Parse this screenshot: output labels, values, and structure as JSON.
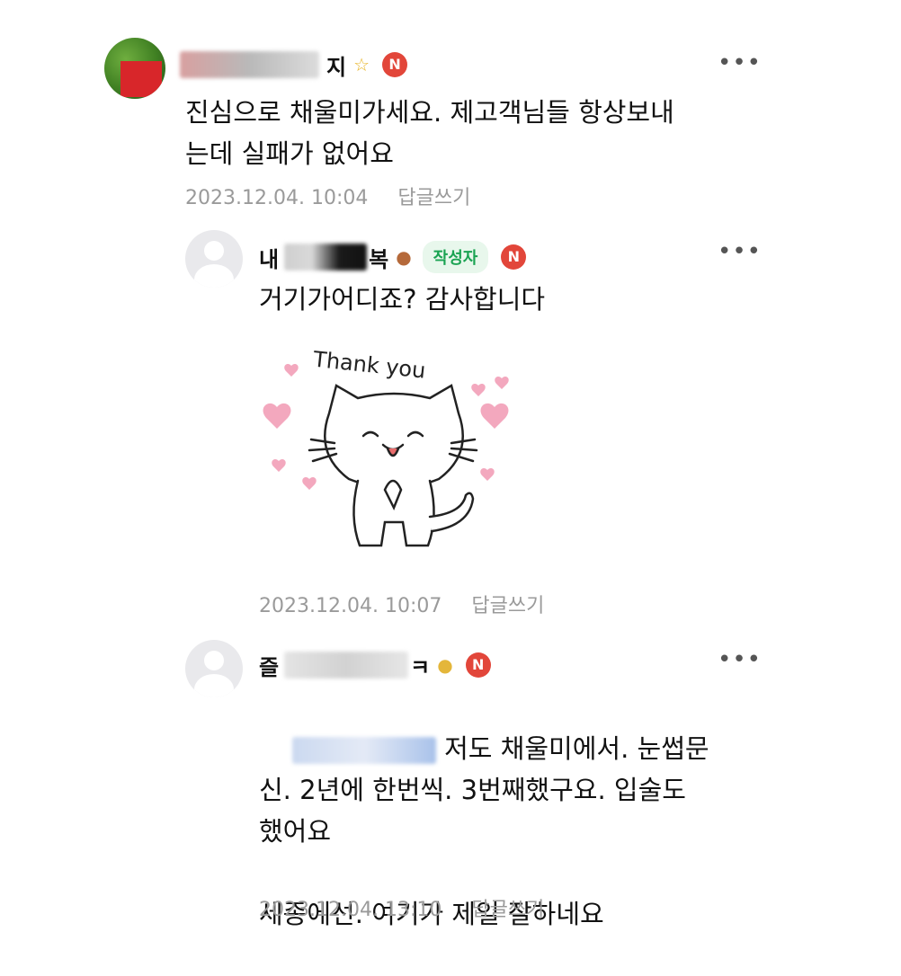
{
  "comments": [
    {
      "name_suffix": "지",
      "text": "진심으로 채울미가세요. 제고객님들 항상보내\n는데 실패가 없어요",
      "timestamp": "2023.12.04. 10:04",
      "reply_label": "답글쓰기",
      "badge": "N",
      "more": "•••"
    },
    {
      "name_prefix": "내",
      "name_suffix": "복",
      "author_tag": "작성자",
      "text": "거기가어디죠? 감사합니다",
      "timestamp": "2023.12.04. 10:07",
      "reply_label": "답글쓰기",
      "badge": "N",
      "more": "•••",
      "sticker_text": "Thank you"
    },
    {
      "name_prefix": "즐",
      "name_suffix": "ㅋ",
      "text_line1": " 저도 채울미에서. 눈썹문",
      "text_rest": "신. 2년에 한번씩. 3번째했구요. 입술도\n했어요\n\n세종에선. 여기가 제일 잘하네요",
      "timestamp": "2023.12.04. 13:10",
      "reply_label": "답글쓰기",
      "badge": "N",
      "more": "•••"
    }
  ],
  "colors": {
    "badge_red": "#e2463a",
    "author_green": "#1aa352",
    "meta_gray": "#9a9a9a",
    "mention_blue": "#3a7bd5"
  }
}
